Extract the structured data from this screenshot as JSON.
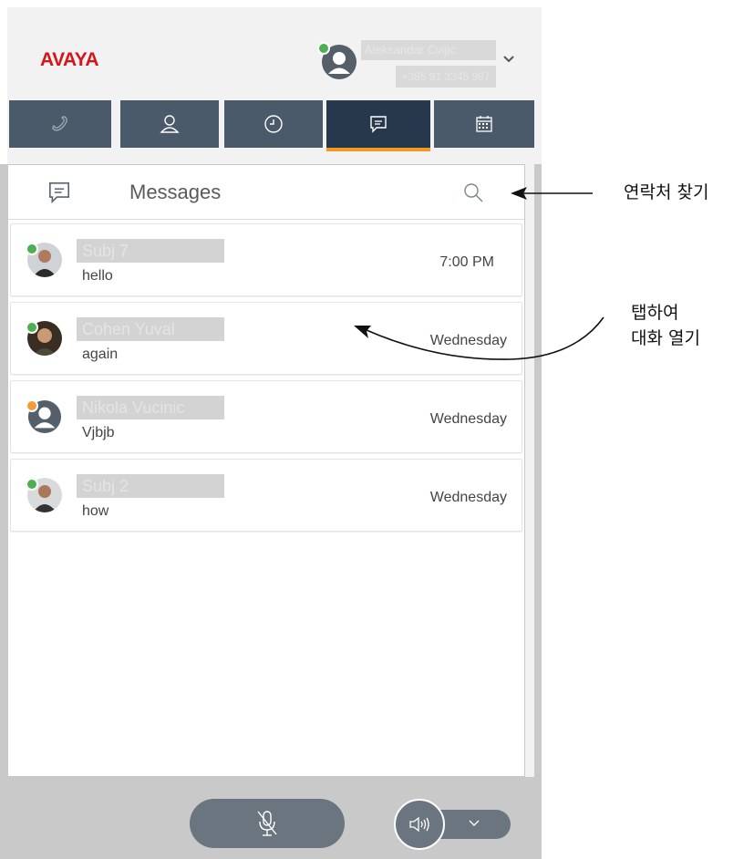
{
  "header": {
    "logo": "AVAYA",
    "user_name": "Aleksandar Cvijic",
    "user_number": "+385 91 3345 987"
  },
  "tabs": [
    {
      "icon": "phone-icon"
    },
    {
      "icon": "contact-icon"
    },
    {
      "icon": "history-icon"
    },
    {
      "icon": "messages-icon",
      "active": true
    },
    {
      "icon": "calendar-icon"
    }
  ],
  "messages_panel": {
    "title": "Messages",
    "conversations": [
      {
        "name": "Subj 7",
        "preview": "hello",
        "time": "7:00 PM",
        "presence": "available"
      },
      {
        "name": "Cohen Yuval",
        "preview": "again",
        "time": "Wednesday",
        "presence": "available"
      },
      {
        "name": "Nikola Vucinic",
        "preview": "Vjbjb",
        "time": "Wednesday",
        "presence": "away"
      },
      {
        "name": "Subj 2",
        "preview": "how",
        "time": "Wednesday",
        "presence": "available"
      }
    ]
  },
  "annotations": {
    "search_note": "연락처 찾기",
    "tap_note_line1": "탭하여",
    "tap_note_line2": "대화 열기"
  },
  "colors": {
    "brand": "#d4161c",
    "tab_bg": "#4b5a6b",
    "tab_active": "#27384d",
    "tab_active_underline": "#f39a25",
    "presence_available": "#4caf50",
    "presence_away": "#f29b38",
    "control_bg": "#6b7580"
  }
}
